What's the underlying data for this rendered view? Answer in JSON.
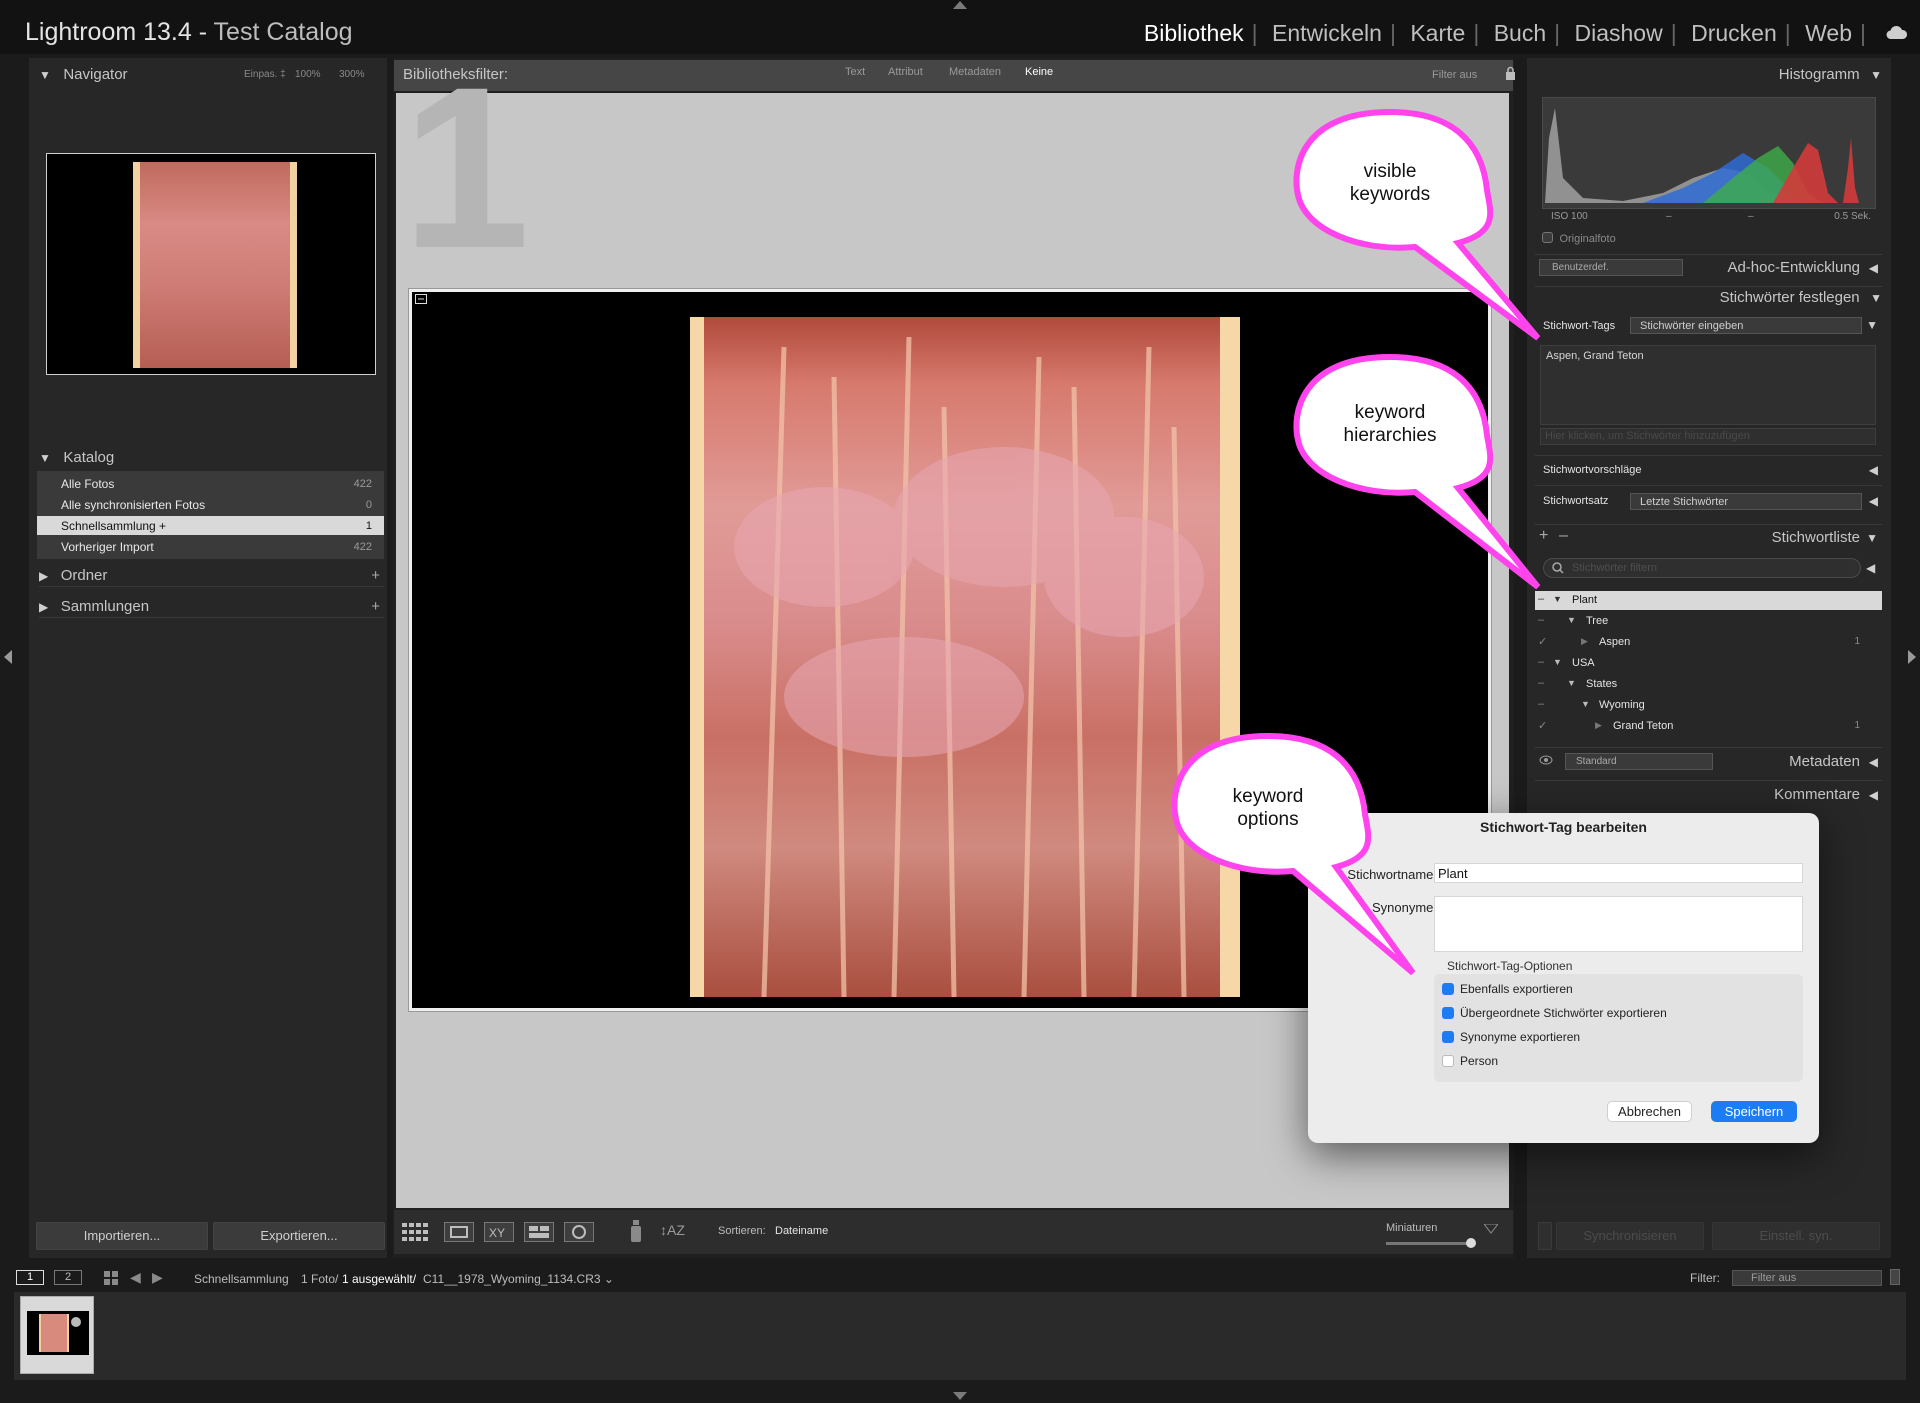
{
  "app": {
    "name": "Lightroom 13.4",
    "separator": " - ",
    "catalog": "Test Catalog"
  },
  "modules": [
    "Bibliothek",
    "Entwickeln",
    "Karte",
    "Buch",
    "Diashow",
    "Drucken",
    "Web"
  ],
  "navigator": {
    "title": "Navigator",
    "zoom": [
      "Einpas. ‡",
      "100%",
      "300%"
    ]
  },
  "catalog_panel": {
    "title": "Katalog",
    "items": [
      {
        "label": "Alle Fotos",
        "count": "422"
      },
      {
        "label": "Alle synchronisierten Fotos",
        "count": "0"
      },
      {
        "label": "Schnellsammlung +",
        "count": "1"
      },
      {
        "label": "Vorheriger Import",
        "count": "422"
      }
    ]
  },
  "folders_panel": {
    "title": "Ordner"
  },
  "collections_panel": {
    "title": "Sammlungen"
  },
  "left_buttons": {
    "import": "Importieren...",
    "export": "Exportieren..."
  },
  "filterbar": {
    "label": "Bibliotheksfilter:",
    "tabs": [
      "Text",
      "Attribut",
      "Metadaten",
      "Keine"
    ],
    "status": "Filter aus"
  },
  "grid": {
    "cell_index": "1"
  },
  "toolbar": {
    "sort_label": "Sortieren:",
    "sort_value": "Dateiname",
    "thumb_label": "Miniaturen"
  },
  "histogram": {
    "title": "Histogramm",
    "iso": "ISO 100",
    "dash1": "–",
    "dash2": "–",
    "shutter": "0.5 Sek.",
    "original_label": "Originalfoto"
  },
  "quick_develop": {
    "preset": "Benutzerdef.",
    "title": "Ad-hoc-Entwicklung"
  },
  "keywording": {
    "title": "Stichwörter festlegen",
    "tags_label": "Stichwort-Tags",
    "tags_select": "Stichwörter eingeben",
    "keywords_text": "Aspen, Grand Teton",
    "add_hint": "Hier klicken, um Stichwörter hinzuzufügen",
    "suggestions_label": "Stichwortvorschläge",
    "set_label": "Stichwortsatz",
    "set_value": "Letzte Stichwörter"
  },
  "keyword_list": {
    "title": "Stichwortliste",
    "add": "+",
    "remove": "–",
    "filter_placeholder": "Stichwörter filtern",
    "items": [
      {
        "label": "Plant",
        "mark": "–",
        "count": ""
      },
      {
        "label": "Tree",
        "mark": "–",
        "count": ""
      },
      {
        "label": "Aspen",
        "mark": "✓",
        "count": "1"
      },
      {
        "label": "USA",
        "mark": "–",
        "count": ""
      },
      {
        "label": "States",
        "mark": "–",
        "count": ""
      },
      {
        "label": "Wyoming",
        "mark": "–",
        "count": ""
      },
      {
        "label": "Grand Teton",
        "mark": "✓",
        "count": "1"
      }
    ]
  },
  "metadata": {
    "preset": "Standard",
    "title": "Metadaten"
  },
  "comments": {
    "title": "Kommentare"
  },
  "right_buttons": {
    "sync": "Synchronisieren",
    "sync_settings": "Einstell. syn."
  },
  "dialog": {
    "title": "Stichwort-Tag bearbeiten",
    "name_label": "Stichwortname:",
    "name_value": "Plant",
    "synonyms_label": "Synonyme:",
    "options_title": "Stichwort-Tag-Optionen",
    "options": [
      {
        "label": "Ebenfalls exportieren",
        "checked": true
      },
      {
        "label": "Übergeordnete Stichwörter exportieren",
        "checked": true
      },
      {
        "label": "Synonyme exportieren",
        "checked": true
      },
      {
        "label": "Person",
        "checked": false
      }
    ],
    "cancel": "Abbrechen",
    "save": "Speichern"
  },
  "annotations": [
    {
      "text": "visible\nkeywords"
    },
    {
      "text": "keyword\nhierarchies"
    },
    {
      "text": "keyword\noptions"
    }
  ],
  "filmstrip_bar": {
    "view1": "1",
    "view2": "2",
    "source": "Schnellsammlung",
    "photo_count": "1 Foto/",
    "selected": "1 ausgewählt/",
    "filename": "C11__1978_Wyoming_1134.CR3 ⌄",
    "filter_label": "Filter:",
    "filter_value": "Filter aus"
  },
  "colors": {
    "accent": "#1c7cf3",
    "bubble": "#ff4cf0",
    "panel": "#2a2a2a",
    "selection": "#d9d9d9"
  }
}
